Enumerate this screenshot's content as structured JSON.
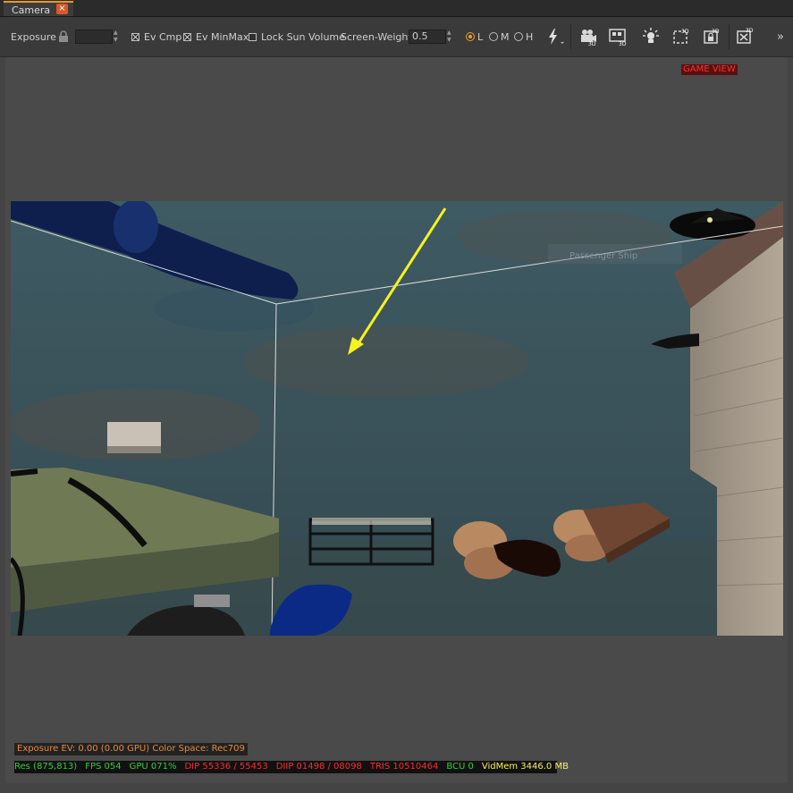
{
  "tab": {
    "label": "Camera",
    "close_glyph": "×"
  },
  "toolbar": {
    "exposure_label": "Exposure",
    "exposure_value": "",
    "ev_cmp_label": "Ev Cmp",
    "ev_minmax_label": "Ev MinMax",
    "lock_sun_volume_label": "Lock Sun Volume",
    "screen_weight_label": "Screen-Weight",
    "screen_weight_value": "0.5",
    "lod_options": [
      "L",
      "M",
      "H"
    ],
    "lod_selected": "L",
    "ev_cmp_checked": true,
    "ev_minmax_checked": true,
    "lock_sun_volume_checked": false,
    "icons": [
      "lock-icon",
      "lightning-icon",
      "camera-3d-icon",
      "display-3d-icon",
      "light-bulb-icon",
      "box-3d-icon",
      "lock-3d-icon",
      "close-3d-icon",
      "overflow-chevron-icon"
    ],
    "overflow_glyph": "»",
    "badge_3d": "3D"
  },
  "viewport": {
    "game_view_label": "GAME VIEW",
    "ghost_label": "Passenger Ship"
  },
  "stats": {
    "exposure_line": "Exposure EV: 0.00 (0.00 GPU)  Color Space: Rec709",
    "res": "Res (875,813)",
    "fps": "FPS 054",
    "gpu": "GPU 071%",
    "dip": "DIP 55336 / 55453",
    "diip": "DIIP 01498 / 08098",
    "tris": "TRIS 10510464",
    "bcu": "BCU 0",
    "vidmem": "VidMem 3446.0 MB"
  },
  "colors": {
    "tab_accent": "#e09a2e",
    "close_button": "#d9582a",
    "radio_selected": "#f0a030",
    "game_view_text": "#ff3030",
    "stat_green": "#30d030",
    "stat_red": "#ff2a2a",
    "stat_yellow": "#f4f45a",
    "stat_orange": "#e88a3a"
  }
}
